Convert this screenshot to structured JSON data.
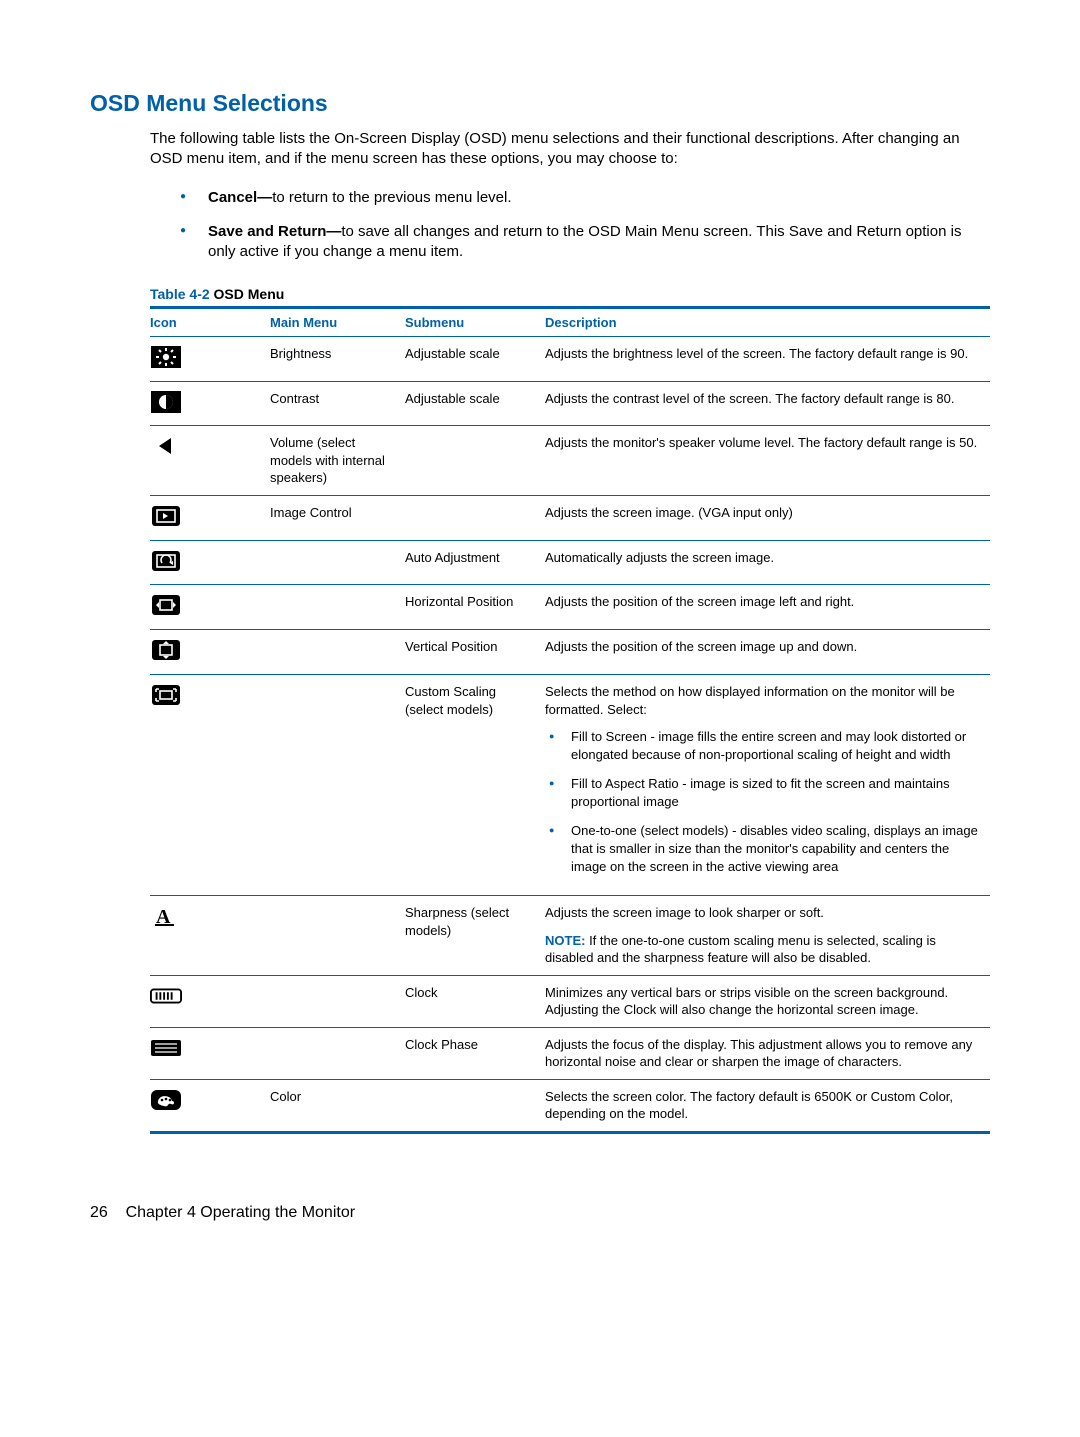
{
  "heading": "OSD Menu Selections",
  "intro": "The following table lists the On-Screen Display (OSD) menu selections and their functional descriptions. After changing an OSD menu item, and if the menu screen has these options, you may choose to:",
  "bullets": [
    {
      "bold": "Cancel—",
      "rest": "to return to the previous menu level."
    },
    {
      "bold": "Save and Return—",
      "rest": "to save all changes and return to the OSD Main Menu screen. This Save and Return option is only active if you change a menu item."
    }
  ],
  "table_caption_num": "Table 4-2",
  "table_caption_title": "  OSD Menu",
  "columns": {
    "icon": "Icon",
    "main": "Main Menu",
    "sub": "Submenu",
    "desc": "Description"
  },
  "rows": {
    "brightness": {
      "main": "Brightness",
      "sub": "Adjustable scale",
      "desc": "Adjusts the brightness level of the screen. The factory default range is 90."
    },
    "contrast": {
      "main": "Contrast",
      "sub": "Adjustable scale",
      "desc": "Adjusts the contrast level of the screen. The factory default range is 80."
    },
    "volume": {
      "main": "Volume (select models with internal speakers)",
      "sub": "",
      "desc": "Adjusts the monitor's speaker volume level. The factory default range is 50."
    },
    "image_control": {
      "main": "Image Control",
      "sub": "",
      "desc": "Adjusts the screen image. (VGA input only)"
    },
    "auto_adj": {
      "main": "",
      "sub": "Auto Adjustment",
      "desc": "Automatically adjusts the screen image."
    },
    "h_pos": {
      "main": "",
      "sub": "Horizontal Position",
      "desc": "Adjusts the position of the screen image left and right."
    },
    "v_pos": {
      "main": "",
      "sub": "Vertical Position",
      "desc": "Adjusts the position of the screen image up and down."
    },
    "custom_scaling": {
      "main": "",
      "sub": "Custom Scaling (select models)",
      "desc": "Selects the method on how displayed information on the monitor will be formatted. Select:",
      "items": [
        "Fill to Screen - image fills the entire screen and may look distorted or elongated because of non-proportional scaling of height and width",
        "Fill to Aspect Ratio - image is sized to fit the screen and maintains proportional image",
        "One-to-one (select models) - disables video scaling, displays an image that is smaller in size than the monitor's capability and centers the image on the screen in the active viewing area"
      ]
    },
    "sharpness": {
      "main": "",
      "sub": "Sharpness (select models)",
      "desc": "Adjusts the screen image to look sharper or soft.",
      "note_label": "NOTE:",
      "note_text": "   If the one-to-one custom scaling menu is selected, scaling is disabled and the sharpness feature will also be disabled."
    },
    "clock": {
      "main": "",
      "sub": "Clock",
      "desc": "Minimizes any vertical bars or strips visible on the screen background. Adjusting the Clock will also change the horizontal screen image."
    },
    "clock_phase": {
      "main": "",
      "sub": "Clock Phase",
      "desc": "Adjusts the focus of the display. This adjustment allows you to remove any horizontal noise and clear or sharpen the image of characters."
    },
    "color": {
      "main": "Color",
      "sub": "",
      "desc": "Selects the screen color. The factory default is 6500K or Custom Color, depending on the model."
    }
  },
  "footer": {
    "page": "26",
    "chapter": "Chapter 4   Operating the Monitor"
  }
}
